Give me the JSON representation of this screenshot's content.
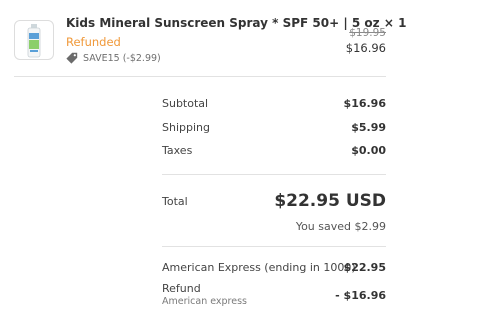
{
  "line_item": {
    "title": "Kids Mineral Sunscreen Spray * SPF 50+ | 5 oz × 1",
    "status": "Refunded",
    "discount_code": "SAVE15 (-$2.99)",
    "original_price": "$19.95",
    "price": "$16.96",
    "thumbnail_icon": "sunscreen-spray-bottle-icon",
    "tag_icon": "tag-icon",
    "status_color": "#f0993a"
  },
  "summary": {
    "subtotal_label": "Subtotal",
    "subtotal_value": "$16.96",
    "shipping_label": "Shipping",
    "shipping_value": "$5.99",
    "taxes_label": "Taxes",
    "taxes_value": "$0.00"
  },
  "total": {
    "label": "Total",
    "value": "$22.95 USD",
    "savings": "You saved $2.99"
  },
  "payments": {
    "method_label": "American Express (ending in 1000)",
    "method_value": "$22.95",
    "refund_label": "Refund",
    "refund_sublabel": "American express",
    "refund_value": "- $16.96"
  }
}
